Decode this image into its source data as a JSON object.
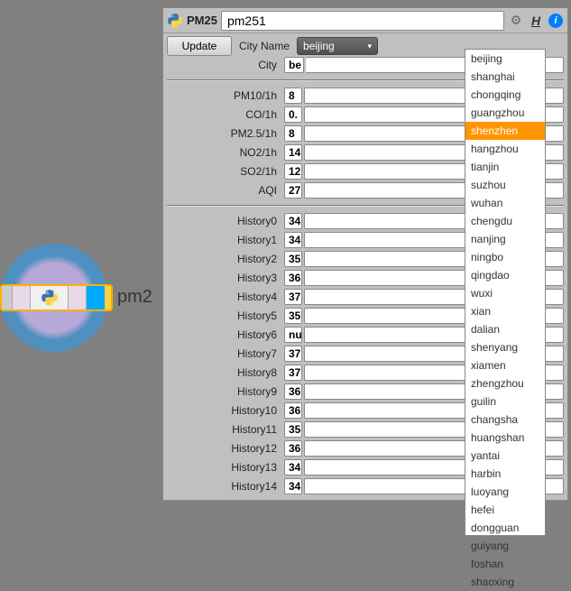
{
  "panel": {
    "title": "PM25",
    "input_value": "pm251"
  },
  "controls": {
    "update_label": "Update",
    "city_name_label": "City Name",
    "dropdown_selected": "beijing",
    "city_label": "City",
    "city_value": "be"
  },
  "metrics": [
    {
      "label": "PM10/1h",
      "value": "8"
    },
    {
      "label": "CO/1h",
      "value": "0."
    },
    {
      "label": "PM2.5/1h",
      "value": "8"
    },
    {
      "label": "NO2/1h",
      "value": "14"
    },
    {
      "label": "SO2/1h",
      "value": "12"
    },
    {
      "label": "AQI",
      "value": "27"
    }
  ],
  "history": [
    {
      "label": "History0",
      "value": "34"
    },
    {
      "label": "History1",
      "value": "34"
    },
    {
      "label": "History2",
      "value": "35"
    },
    {
      "label": "History3",
      "value": "36"
    },
    {
      "label": "History4",
      "value": "37"
    },
    {
      "label": "History5",
      "value": "35"
    },
    {
      "label": "History6",
      "value": "nu"
    },
    {
      "label": "History7",
      "value": "37"
    },
    {
      "label": "History8",
      "value": "37"
    },
    {
      "label": "History9",
      "value": "36"
    },
    {
      "label": "History10",
      "value": "36"
    },
    {
      "label": "History11",
      "value": "35"
    },
    {
      "label": "History12",
      "value": "36"
    },
    {
      "label": "History13",
      "value": "34"
    },
    {
      "label": "History14",
      "value": "34"
    }
  ],
  "dropdown_options": [
    "beijing",
    "shanghai",
    "chongqing",
    "guangzhou",
    "shenzhen",
    "hangzhou",
    "tianjin",
    "suzhou",
    "wuhan",
    "chengdu",
    "nanjing",
    "ningbo",
    "qingdao",
    "wuxi",
    "xian",
    "dalian",
    "shenyang",
    "xiamen",
    "zhengzhou",
    "guilin",
    "changsha",
    "huangshan",
    "yantai",
    "harbin",
    "luoyang",
    "hefei",
    "dongguan",
    "guiyang",
    "foshan",
    "shaoxing"
  ],
  "dropdown_highlighted": "shenzhen",
  "node_label": "pm2"
}
